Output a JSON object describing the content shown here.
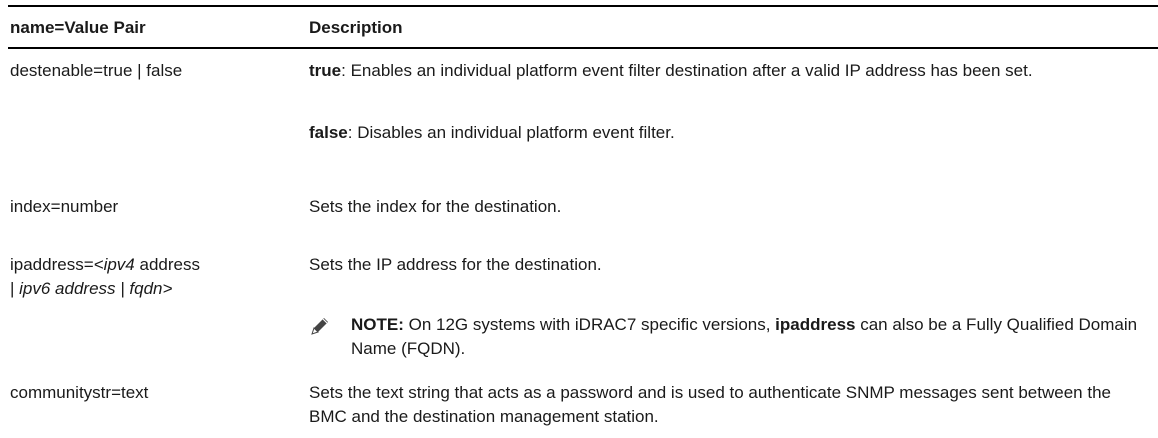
{
  "header": {
    "col1": "name=Value Pair",
    "col2": "Description"
  },
  "rows": {
    "destenable": {
      "name": "destenable=true | false",
      "true_label": "true",
      "true_desc": ": Enables an individual platform event filter destination after a valid IP address has been set.",
      "false_label": "false",
      "false_desc": ": Disables an individual platform event filter."
    },
    "index": {
      "name": "index=number",
      "desc": "Sets the index for the destination."
    },
    "ipaddress": {
      "name_a": "ipaddress=",
      "name_b": "<ipv4",
      "name_c": " address",
      "name_d": "| ",
      "name_e": "ipv6 address | fqdn>",
      "desc": "Sets the IP address for the destination.",
      "note_label": "NOTE:",
      "note_a": " On 12G systems with iDRAC7 specific versions, ",
      "note_b": "ipaddress",
      "note_c": " can also be a Fully Qualified Domain Name (FQDN).",
      "note_icon": "pencil-note-icon"
    },
    "communitystr": {
      "name": "communitystr=text",
      "desc": "Sets the text string that acts as a password and is used to authenticate SNMP messages sent between the BMC and the destination management station."
    }
  }
}
